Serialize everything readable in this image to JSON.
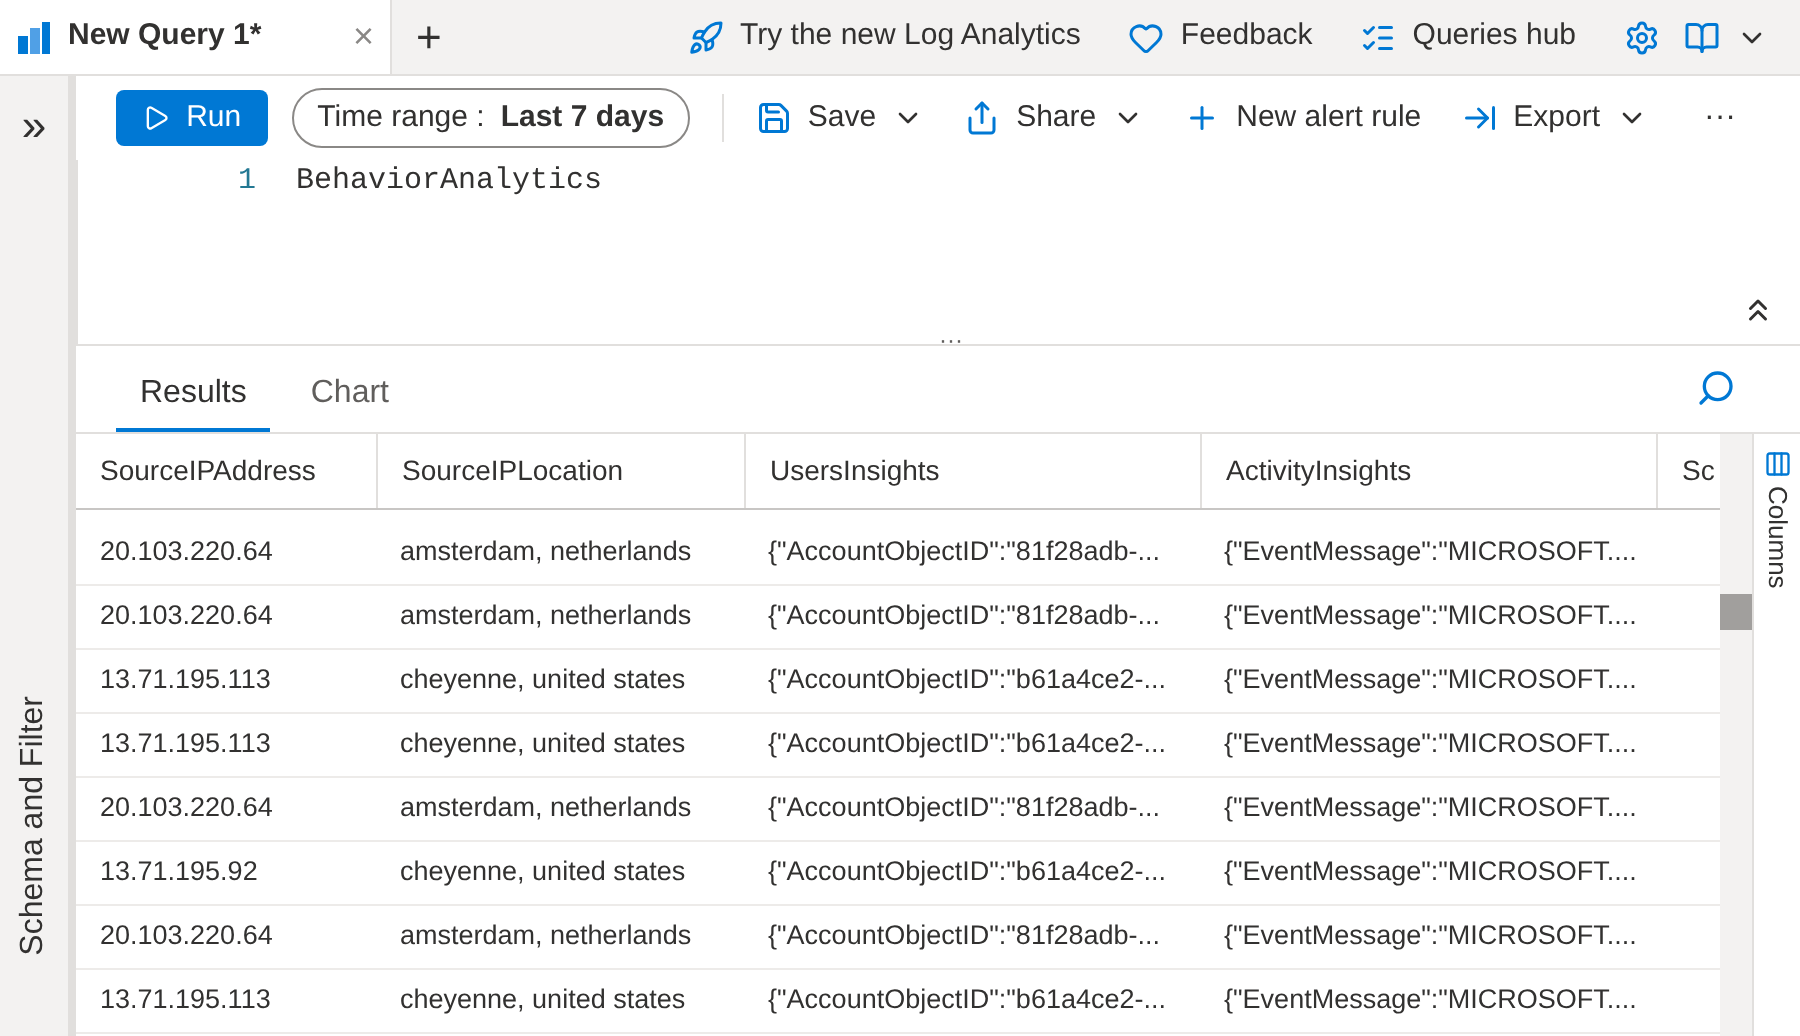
{
  "query_tab": {
    "title": "New Query 1*",
    "close": "×",
    "add": "+"
  },
  "top_links": [
    {
      "kind": "rocket",
      "label": "Try the new Log Analytics"
    },
    {
      "kind": "heart",
      "label": "Feedback"
    },
    {
      "kind": "list",
      "label": "Queries hub"
    }
  ],
  "sidebar": {
    "expand": "»",
    "label": "Schema and Filter"
  },
  "toolbar": {
    "run": "Run",
    "time_range_label": "Time range :",
    "time_range_value": "Last 7 days",
    "actions": [
      {
        "kind": "save",
        "label": "Save",
        "dropdown": true
      },
      {
        "kind": "share",
        "label": "Share",
        "dropdown": true
      },
      {
        "kind": "plus",
        "label": "New alert rule",
        "dropdown": false
      },
      {
        "kind": "export",
        "label": "Export",
        "dropdown": true
      }
    ],
    "more": "···"
  },
  "editor": {
    "lines": [
      {
        "number": "1",
        "code": "BehaviorAnalytics"
      }
    ],
    "splitter": "···"
  },
  "results_tabs": [
    {
      "label": "Results",
      "selected": true
    },
    {
      "label": "Chart",
      "selected": false
    }
  ],
  "table": {
    "columns": [
      "SourceIPAddress",
      "SourceIPLocation",
      "UsersInsights",
      "ActivityInsights",
      "Sc"
    ],
    "rows": [
      [
        "20.103.220.64",
        "amsterdam, netherlands",
        "{\"AccountObjectID\":\"81f28adb-...",
        "{\"EventMessage\":\"MICROSOFT...."
      ],
      [
        "20.103.220.64",
        "amsterdam, netherlands",
        "{\"AccountObjectID\":\"81f28adb-...",
        "{\"EventMessage\":\"MICROSOFT...."
      ],
      [
        "13.71.195.113",
        "cheyenne, united states",
        "{\"AccountObjectID\":\"b61a4ce2-...",
        "{\"EventMessage\":\"MICROSOFT...."
      ],
      [
        "13.71.195.113",
        "cheyenne, united states",
        "{\"AccountObjectID\":\"b61a4ce2-...",
        "{\"EventMessage\":\"MICROSOFT...."
      ],
      [
        "20.103.220.64",
        "amsterdam, netherlands",
        "{\"AccountObjectID\":\"81f28adb-...",
        "{\"EventMessage\":\"MICROSOFT...."
      ],
      [
        "13.71.195.92",
        "cheyenne, united states",
        "{\"AccountObjectID\":\"b61a4ce2-...",
        "{\"EventMessage\":\"MICROSOFT...."
      ],
      [
        "20.103.220.64",
        "amsterdam, netherlands",
        "{\"AccountObjectID\":\"81f28adb-...",
        "{\"EventMessage\":\"MICROSOFT...."
      ],
      [
        "13.71.195.113",
        "cheyenne, united states",
        "{\"AccountObjectID\":\"b61a4ce2-...",
        "{\"EventMessage\":\"MICROSOFT...."
      ]
    ]
  },
  "columns_panel": {
    "label": "Columns"
  }
}
